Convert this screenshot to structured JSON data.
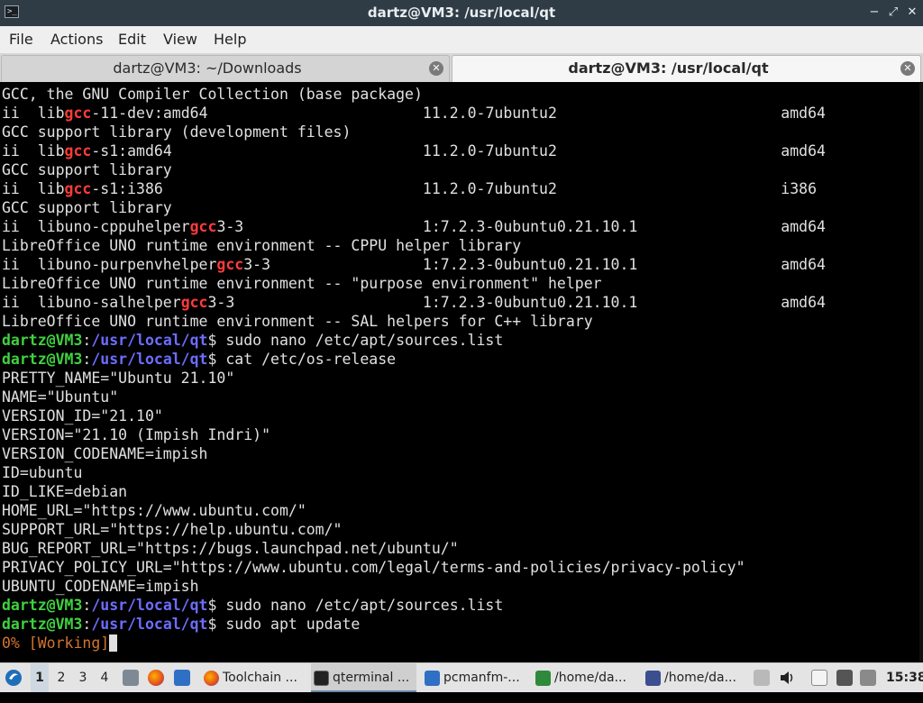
{
  "window": {
    "title": "dartz@VM3: /usr/local/qt",
    "icon_glyph": ">_",
    "buttons": {
      "minimize": "−",
      "maximize": "⤢",
      "close": "✕"
    }
  },
  "menu": [
    "File",
    "Actions",
    "Edit",
    "View",
    "Help"
  ],
  "tabs": [
    {
      "label": "dartz@VM3: ~/Downloads",
      "active": false
    },
    {
      "label": "dartz@VM3: /usr/local/qt",
      "active": true
    }
  ],
  "terminal": {
    "colors": {
      "prompt_user": "#3fd13f",
      "prompt_path": "#6d6dff",
      "match": "#ff3b3b",
      "progress": "#d4742e"
    },
    "prompt_user": "dartz@VM3",
    "prompt_path": "/usr/local/qt",
    "lines": [
      "GCC, the GNU Compiler Collection (base package)",
      "ii  libgcc-11-dev:amd64                        11.2.0-7ubuntu2                         amd64",
      "GCC support library (development files)",
      "ii  libgcc-s1:amd64                            11.2.0-7ubuntu2                         amd64",
      "GCC support library",
      "ii  libgcc-s1:i386                             11.2.0-7ubuntu2                         i386",
      "GCC support library",
      "ii  libuno-cppuhelpergcc3-3                    1:7.2.3-0ubuntu0.21.10.1                amd64",
      "LibreOffice UNO runtime environment -- CPPU helper library",
      "ii  libuno-purpenvhelpergcc3-3                 1:7.2.3-0ubuntu0.21.10.1                amd64",
      "LibreOffice UNO runtime environment -- \"purpose environment\" helper",
      "ii  libuno-salhelpergcc3-3                     1:7.2.3-0ubuntu0.21.10.1                amd64",
      "LibreOffice UNO runtime environment -- SAL helpers for C++ library",
      "$ sudo nano /etc/apt/sources.list",
      "$ cat /etc/os-release",
      "PRETTY_NAME=\"Ubuntu 21.10\"",
      "NAME=\"Ubuntu\"",
      "VERSION_ID=\"21.10\"",
      "VERSION=\"21.10 (Impish Indri)\"",
      "VERSION_CODENAME=impish",
      "ID=ubuntu",
      "ID_LIKE=debian",
      "HOME_URL=\"https://www.ubuntu.com/\"",
      "SUPPORT_URL=\"https://help.ubuntu.com/\"",
      "BUG_REPORT_URL=\"https://bugs.launchpad.net/ubuntu/\"",
      "PRIVACY_POLICY_URL=\"https://www.ubuntu.com/legal/terms-and-policies/privacy-policy\"",
      "UBUNTU_CODENAME=impish",
      "$ sudo nano /etc/apt/sources.list",
      "$ sudo apt update",
      "0% [Working]"
    ]
  },
  "taskbar": {
    "workspaces": [
      "1",
      "2",
      "3",
      "4"
    ],
    "active_workspace": "1",
    "tasks": [
      {
        "label": "Toolchain ...",
        "icon": "firefox-icon"
      },
      {
        "label": "qterminal ...",
        "icon": "terminal-icon",
        "active": true
      },
      {
        "label": "pcmanfm-...",
        "icon": "folder-icon"
      },
      {
        "label": "/home/da...",
        "icon": "notepad-icon"
      },
      {
        "label": "/home/da...",
        "icon": "editor-icon"
      }
    ],
    "clock": "15:38"
  }
}
